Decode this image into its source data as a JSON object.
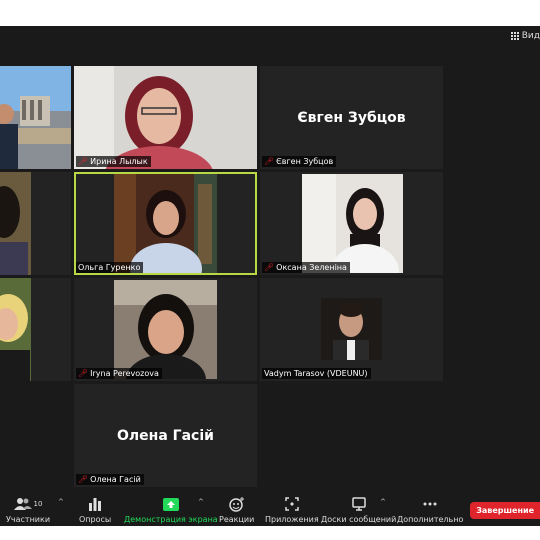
{
  "header": {
    "view_label": "Вид"
  },
  "participants": [
    {
      "name": "",
      "muted": false
    },
    {
      "name": "Ирина Лылык",
      "muted": true
    },
    {
      "name": "Євген Зубцов",
      "muted": true,
      "display": "Євген Зубцов"
    },
    {
      "name": "",
      "muted": false
    },
    {
      "name": "Ольга Гуренко",
      "muted": false,
      "active_speaker": true
    },
    {
      "name": "Оксана Зеленіна",
      "muted": true
    },
    {
      "name": "",
      "muted": false
    },
    {
      "name": "Iryna Perevozova",
      "muted": true
    },
    {
      "name": "Vadym Tarasov (VDEUNU)",
      "muted": false
    },
    {
      "name": "Олена Гасій",
      "muted": true,
      "display": "Олена Гасій"
    }
  ],
  "toolbar": {
    "participants_label": "Участники",
    "participants_count": "10",
    "polls_label": "Опросы",
    "share_label": "Демонстрация экрана",
    "reactions_label": "Реакции",
    "apps_label": "Приложения",
    "whiteboards_label": "Доски сообщений",
    "more_label": "Дополнительно",
    "end_label": "Завершение"
  },
  "colors": {
    "accent_green": "#b9d846",
    "share_green": "#23d959",
    "end_red": "#e0242b",
    "mute_red": "#e0242b"
  }
}
